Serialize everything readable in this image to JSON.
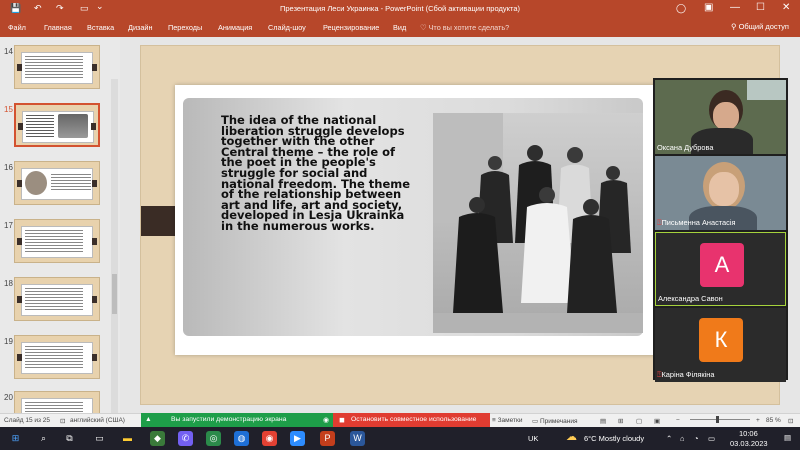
{
  "titlebar": {
    "title": "Презентация Леси Украинка - PowerPoint (Сбой активации продукта)",
    "save_icon": "💾",
    "undo_icon": "↶",
    "redo_icon": "↷",
    "present_icon": "▭",
    "dropdown_icon": "⌄",
    "user_icon": "◯",
    "ribbon_options_icon": "▣",
    "minimize_icon": "—",
    "maximize_icon": "☐",
    "close_icon": "✕"
  },
  "ribbon": {
    "tabs": [
      "Файл",
      "Главная",
      "Вставка",
      "Дизайн",
      "Переходы",
      "Анимация",
      "Слайд-шоу",
      "Рецензирование",
      "Вид"
    ],
    "search_placeholder": "♡ Что вы хотите сделать?",
    "share_label": "Общий доступ"
  },
  "thumbnails": [
    {
      "num": "14"
    },
    {
      "num": "15"
    },
    {
      "num": "16"
    },
    {
      "num": "17"
    },
    {
      "num": "18"
    },
    {
      "num": "19"
    },
    {
      "num": "20"
    }
  ],
  "slide": {
    "text": "The idea  of the national liberation struggle develops together with the other Central theme – the role of the poet in the people's struggle for social and national freedom. The theme of the relationship between art and life, art and society, developed in Lesja Ukrainka in the numerous works."
  },
  "participants": [
    {
      "name": "Оксана Дуброва"
    },
    {
      "name": "Письменна Анастасія"
    },
    {
      "name": "Александра Савон",
      "initial": "А",
      "color": "#e8336e"
    },
    {
      "name": "Каріна Філякіна",
      "initial": "К",
      "color": "#f07a1a"
    }
  ],
  "statusbar": {
    "slide_info": "Слайд 15 из 25",
    "language": "английский (США)",
    "sharing": "Вы запустили демонстрацию экрана",
    "stop_sharing": "Остановить совместное использование",
    "notes": "Заметки",
    "comments": "Примечания",
    "zoom": "85 %"
  },
  "taskbar": {
    "lang": "UK",
    "weather": "6°C  Mostly cloudy",
    "time": "10:06",
    "date": "03.03.2023"
  }
}
